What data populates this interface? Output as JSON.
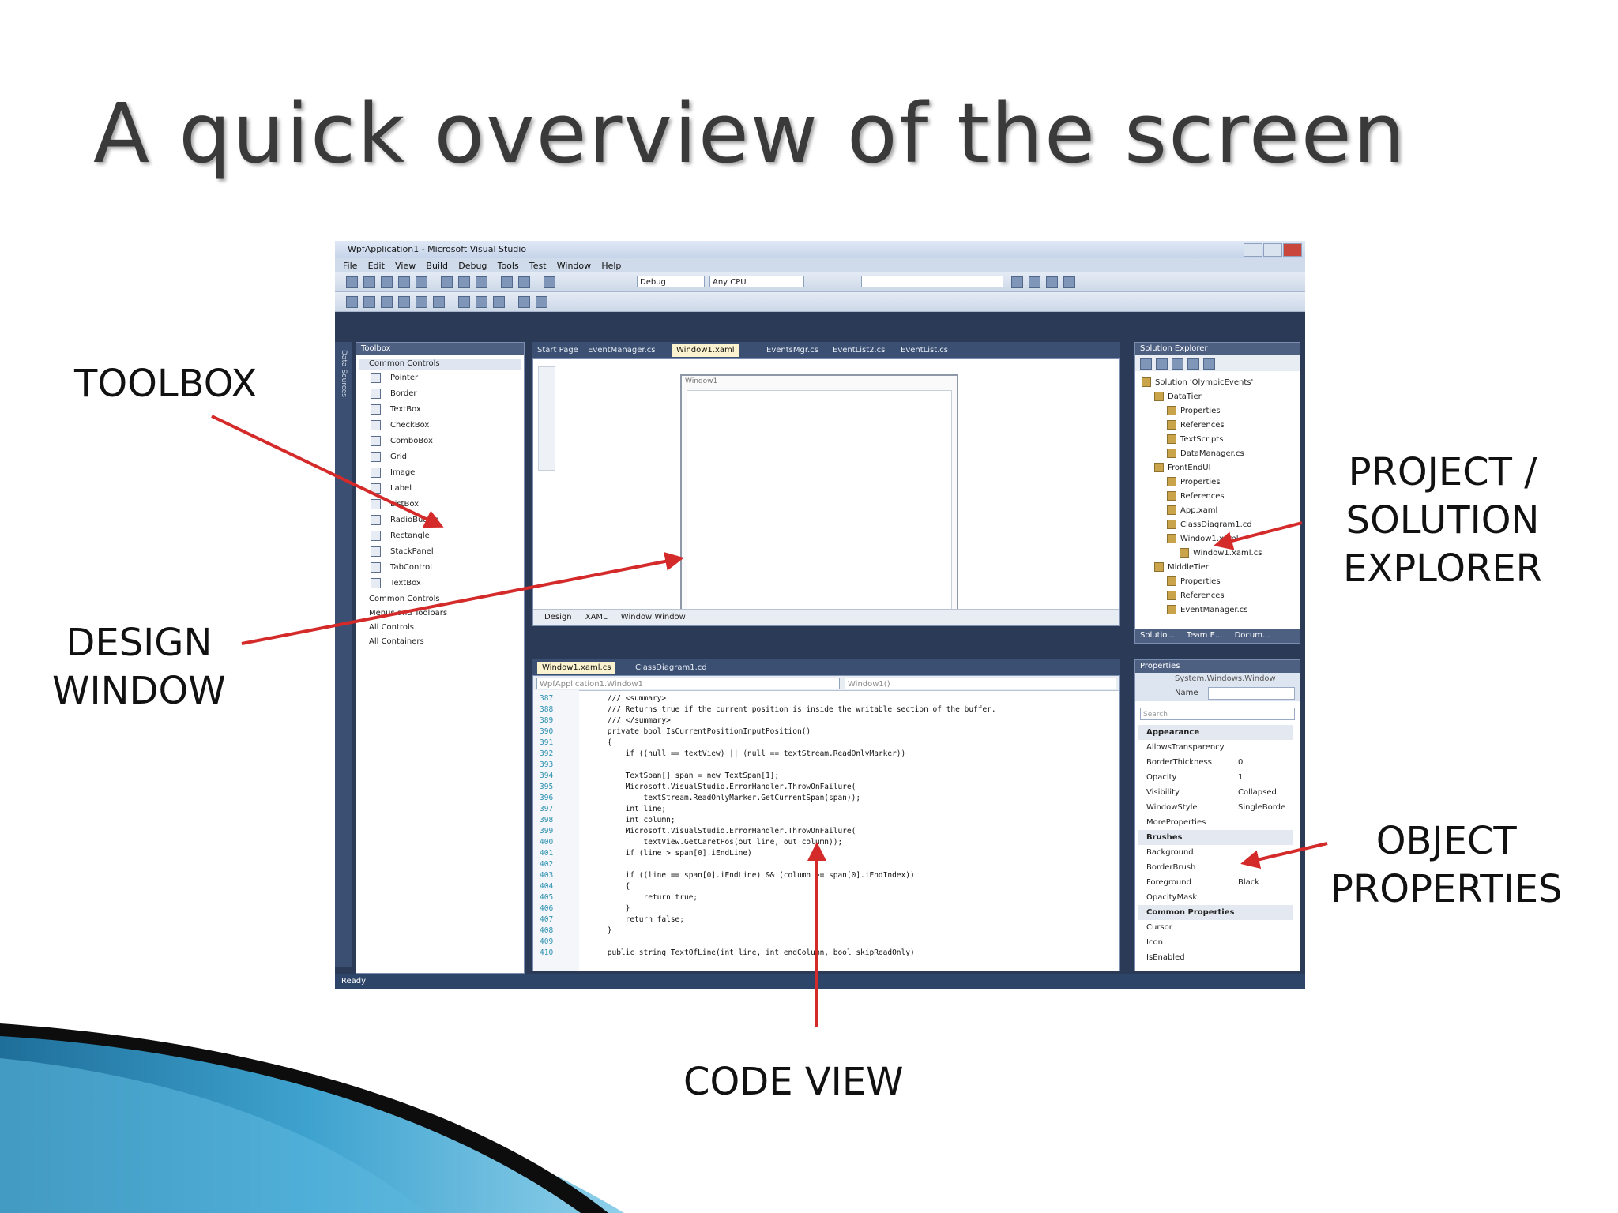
{
  "slide": {
    "title": "A quick overview of the screen",
    "callouts": {
      "toolbox": "TOOLBOX",
      "design_window": "DESIGN\nWINDOW",
      "solution_explorer": "PROJECT /\nSOLUTION\nEXPLORER",
      "object_properties": "OBJECT\nPROPERTIES",
      "code_view": "CODE VIEW"
    }
  },
  "vs": {
    "window_title": "WpfApplication1 - Microsoft Visual Studio",
    "menu": [
      "File",
      "Edit",
      "View",
      "Build",
      "Debug",
      "Tools",
      "Test",
      "Window",
      "Help"
    ],
    "config_combo": "Debug",
    "platform_combo": "Any CPU",
    "side_strip_label": "Data Sources",
    "toolbox": {
      "title": "Toolbox",
      "open_category": "Common Controls",
      "items": [
        "Pointer",
        "Border",
        "TextBox",
        "CheckBox",
        "ComboBox",
        "Grid",
        "Image",
        "Label",
        "ListBox",
        "RadioButton",
        "Rectangle",
        "StackPanel",
        "TabControl",
        "TextBox"
      ],
      "categories": [
        "Common Controls",
        "Menus and Toolbars",
        "All Controls",
        "All Containers"
      ]
    },
    "doc_tabs": [
      "Start Page",
      "EventManager.cs",
      "Window1.xaml",
      "EventsMgr.cs",
      "EventList2.cs",
      "EventList.cs"
    ],
    "active_doc_tab": "Window1.xaml",
    "design": {
      "window_caption": "Window1",
      "bar_design": "Design",
      "bar_xaml": "XAML",
      "bar_breadcrumb": "Window  Window"
    },
    "code_tabs": [
      "Window1.xaml.cs",
      "ClassDiagram1.cd"
    ],
    "code": {
      "class_combo": "WpfApplication1.Window1",
      "member_combo": "Window1()",
      "lines": [
        {
          "n": "387",
          "t": "        /// <summary>"
        },
        {
          "n": "388",
          "t": "        /// Returns true if the current position is inside the writable section of the buffer."
        },
        {
          "n": "389",
          "t": "        /// </summary>"
        },
        {
          "n": "390",
          "t": "        private bool IsCurrentPositionInputPosition()"
        },
        {
          "n": "391",
          "t": "        {"
        },
        {
          "n": "392",
          "t": "            if ((null == textView) || (null == textStream.ReadOnlyMarker))"
        },
        {
          "n": "393",
          "t": ""
        },
        {
          "n": "394",
          "t": "            TextSpan[] span = new TextSpan[1];"
        },
        {
          "n": "395",
          "t": "            Microsoft.VisualStudio.ErrorHandler.ThrowOnFailure("
        },
        {
          "n": "396",
          "t": "                textStream.ReadOnlyMarker.GetCurrentSpan(span));"
        },
        {
          "n": "397",
          "t": "            int line;"
        },
        {
          "n": "398",
          "t": "            int column;"
        },
        {
          "n": "399",
          "t": "            Microsoft.VisualStudio.ErrorHandler.ThrowOnFailure("
        },
        {
          "n": "400",
          "t": "                textView.GetCaretPos(out line, out column));"
        },
        {
          "n": "401",
          "t": "            if (line > span[0].iEndLine)"
        },
        {
          "n": "402",
          "t": ""
        },
        {
          "n": "403",
          "t": "            if ((line == span[0].iEndLine) && (column >= span[0].iEndIndex))"
        },
        {
          "n": "404",
          "t": "            {"
        },
        {
          "n": "405",
          "t": "                return true;"
        },
        {
          "n": "406",
          "t": "            }"
        },
        {
          "n": "407",
          "t": "            return false;"
        },
        {
          "n": "408",
          "t": "        }"
        },
        {
          "n": "409",
          "t": ""
        },
        {
          "n": "410",
          "t": "        public string TextOfLine(int line, int endColumn, bool skipReadOnly)"
        }
      ]
    },
    "solution": {
      "title": "Solution Explorer",
      "items": [
        {
          "label": "Solution 'OlympicEvents'",
          "indent": 0
        },
        {
          "label": "DataTier",
          "indent": 1
        },
        {
          "label": "Properties",
          "indent": 2
        },
        {
          "label": "References",
          "indent": 2
        },
        {
          "label": "TextScripts",
          "indent": 2
        },
        {
          "label": "DataManager.cs",
          "indent": 2
        },
        {
          "label": "FrontEndUI",
          "indent": 1
        },
        {
          "label": "Properties",
          "indent": 2
        },
        {
          "label": "References",
          "indent": 2
        },
        {
          "label": "App.xaml",
          "indent": 2
        },
        {
          "label": "ClassDiagram1.cd",
          "indent": 2
        },
        {
          "label": "Window1.xaml",
          "indent": 2
        },
        {
          "label": "Window1.xaml.cs",
          "indent": 3
        },
        {
          "label": "MiddleTier",
          "indent": 1
        },
        {
          "label": "Properties",
          "indent": 2
        },
        {
          "label": "References",
          "indent": 2
        },
        {
          "label": "EventManager.cs",
          "indent": 2
        }
      ],
      "bottom_tabs": [
        "Solutio...",
        "Team E...",
        "Docum..."
      ]
    },
    "properties": {
      "title": "Properties",
      "type_label": "System.Windows.Window",
      "name_label": "Name",
      "search_placeholder": "Search",
      "rows": [
        {
          "name": "Appearance",
          "value": "",
          "cat": true
        },
        {
          "name": "AllowsTransparency",
          "value": "",
          "cat": false
        },
        {
          "name": "BorderThickness",
          "value": "0",
          "cat": false
        },
        {
          "name": "Opacity",
          "value": "1",
          "cat": false
        },
        {
          "name": "Visibility",
          "value": "Collapsed",
          "cat": false
        },
        {
          "name": "WindowStyle",
          "value": "SingleBorde",
          "cat": false
        },
        {
          "name": "MoreProperties",
          "value": "",
          "cat": false
        },
        {
          "name": "Brushes",
          "value": "",
          "cat": true
        },
        {
          "name": "Background",
          "value": "",
          "cat": false
        },
        {
          "name": "BorderBrush",
          "value": "",
          "cat": false
        },
        {
          "name": "Foreground",
          "value": "Black",
          "cat": false
        },
        {
          "name": "OpacityMask",
          "value": "",
          "cat": false
        },
        {
          "name": "Common Properties",
          "value": "",
          "cat": true
        },
        {
          "name": "Cursor",
          "value": "",
          "cat": false
        },
        {
          "name": "Icon",
          "value": "",
          "cat": false
        },
        {
          "name": "IsEnabled",
          "value": "",
          "cat": false
        }
      ]
    },
    "status": "Ready"
  },
  "colors": {
    "arrow": "#d42a2a",
    "title_text": "#3a3a3a",
    "vs_frame": "#2b3b57"
  }
}
